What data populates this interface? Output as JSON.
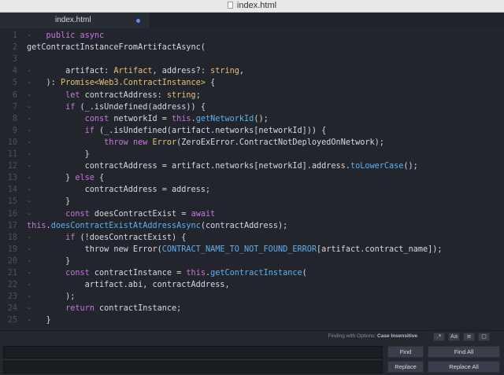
{
  "window": {
    "title": "index.html"
  },
  "tab": {
    "label": "index.html"
  },
  "editor": {
    "lines": [
      {
        "n": "1",
        "g": "-",
        "t": [
          [
            "    ",
            "pu"
          ],
          [
            "public async",
            "kw"
          ]
        ]
      },
      {
        "n": "2",
        "g": "",
        "t": [
          [
            "getContractInstanceFromArtifactAsync(",
            "pu"
          ]
        ]
      },
      {
        "n": "3",
        "g": "",
        "t": []
      },
      {
        "n": "4",
        "g": "-",
        "t": [
          [
            "        artifact: ",
            "pu"
          ],
          [
            "Artifact",
            "ty"
          ],
          [
            ", address?: ",
            "pu"
          ],
          [
            "string",
            "ty"
          ],
          [
            ",",
            "pu"
          ]
        ]
      },
      {
        "n": "5",
        "g": "-",
        "t": [
          [
            "    ): ",
            "pu"
          ],
          [
            "Promise<Web3.ContractInstance>",
            "ty"
          ],
          [
            " {",
            "pu"
          ]
        ]
      },
      {
        "n": "6",
        "g": "-",
        "t": [
          [
            "        ",
            "pu"
          ],
          [
            "let",
            "kw"
          ],
          [
            " contractAddress: ",
            "pu"
          ],
          [
            "string",
            "ty"
          ],
          [
            ";",
            "pu"
          ]
        ]
      },
      {
        "n": "7",
        "g": "-",
        "t": [
          [
            "        ",
            "pu"
          ],
          [
            "if",
            "kw"
          ],
          [
            " (_.isUndefined(address)) {",
            "pu"
          ]
        ]
      },
      {
        "n": "8",
        "g": "-",
        "t": [
          [
            "            ",
            "pu"
          ],
          [
            "const",
            "kw"
          ],
          [
            " networkId = ",
            "pu"
          ],
          [
            "this",
            "kw"
          ],
          [
            ".",
            "pu"
          ],
          [
            "getNetworkId",
            "fn"
          ],
          [
            "();",
            "pu"
          ]
        ]
      },
      {
        "n": "9",
        "g": "-",
        "t": [
          [
            "            ",
            "pu"
          ],
          [
            "if",
            "kw"
          ],
          [
            " (_.isUndefined(artifact.networks[networkId])) {",
            "pu"
          ]
        ]
      },
      {
        "n": "10",
        "g": "-",
        "t": [
          [
            "                ",
            "pu"
          ],
          [
            "throw new",
            "kw"
          ],
          [
            " ",
            "pu"
          ],
          [
            "Error",
            "ty"
          ],
          [
            "(ZeroExError.ContractNotDeployedOnNetwork);",
            "pu"
          ]
        ]
      },
      {
        "n": "11",
        "g": "-",
        "t": [
          [
            "            }",
            "pu"
          ]
        ]
      },
      {
        "n": "12",
        "g": "-",
        "t": [
          [
            "            contractAddress = artifact.networks[networkId].address.",
            "pu"
          ],
          [
            "toLowerCase",
            "fn"
          ],
          [
            "();",
            "pu"
          ]
        ]
      },
      {
        "n": "13",
        "g": "-",
        "t": [
          [
            "        } ",
            "pu"
          ],
          [
            "else",
            "kw"
          ],
          [
            " {",
            "pu"
          ]
        ]
      },
      {
        "n": "14",
        "g": "-",
        "t": [
          [
            "            contractAddress = address;",
            "pu"
          ]
        ]
      },
      {
        "n": "15",
        "g": "-",
        "t": [
          [
            "        }",
            "pu"
          ]
        ]
      },
      {
        "n": "16",
        "g": "-",
        "t": [
          [
            "        ",
            "pu"
          ],
          [
            "const",
            "kw"
          ],
          [
            " doesContractExist = ",
            "pu"
          ],
          [
            "await",
            "kw"
          ]
        ]
      },
      {
        "n": "17",
        "g": "",
        "t": [
          [
            "this",
            "kw"
          ],
          [
            ".",
            "pu"
          ],
          [
            "doesContractExistAtAddressAsync",
            "fn"
          ],
          [
            "(contractAddress);",
            "pu"
          ]
        ]
      },
      {
        "n": "18",
        "g": "-",
        "t": [
          [
            "        ",
            "pu"
          ],
          [
            "if",
            "kw"
          ],
          [
            " (!doesContractExist) {",
            "pu"
          ]
        ]
      },
      {
        "n": "19",
        "g": "-",
        "t": [
          [
            "            throw new Error(",
            "pu"
          ],
          [
            "CONTRACT_NAME_TO_NOT_FOUND_ERROR",
            "fn"
          ],
          [
            "[artifact.contract_name]);",
            "pu"
          ]
        ]
      },
      {
        "n": "20",
        "g": "-",
        "t": [
          [
            "        }",
            "pu"
          ]
        ]
      },
      {
        "n": "21",
        "g": "-",
        "t": [
          [
            "        ",
            "pu"
          ],
          [
            "const",
            "kw"
          ],
          [
            " contractInstance = ",
            "pu"
          ],
          [
            "this",
            "kw"
          ],
          [
            ".",
            "pu"
          ],
          [
            "getContractInstance",
            "fn"
          ],
          [
            "(",
            "pu"
          ]
        ]
      },
      {
        "n": "22",
        "g": "-",
        "t": [
          [
            "            artifact.abi, contractAddress,",
            "pu"
          ]
        ]
      },
      {
        "n": "23",
        "g": "-",
        "t": [
          [
            "        );",
            "pu"
          ]
        ]
      },
      {
        "n": "24",
        "g": "-",
        "t": [
          [
            "        ",
            "pu"
          ],
          [
            "return",
            "kw"
          ],
          [
            " contractInstance;",
            "pu"
          ]
        ]
      },
      {
        "n": "25",
        "g": "-",
        "t": [
          [
            "    }",
            "pu"
          ]
        ]
      }
    ]
  },
  "find": {
    "options_label": "Finding with Options:",
    "options_value": "Case Insensitive",
    "option_buttons": [
      ".*",
      "Aa",
      "≡",
      "▢"
    ],
    "find_value": "",
    "replace_value": "",
    "find_button": "Find",
    "find_all_button": "Find All",
    "replace_button": "Replace",
    "replace_all_button": "Replace All"
  }
}
